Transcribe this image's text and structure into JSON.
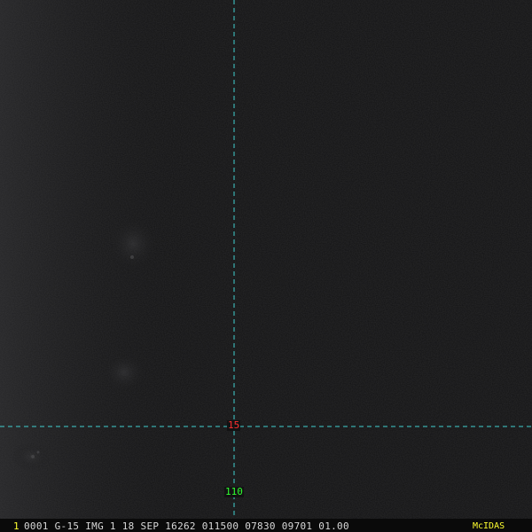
{
  "image_viewer": {
    "colors": {
      "background": "#121213",
      "grid_line": "#40d0d0",
      "latitude_label": "#ff3030",
      "longitude_label": "#30ff30",
      "status_text": "#d8d8d8",
      "highlight": "#ffff30"
    },
    "grid": {
      "latitude_label": "15",
      "longitude_label": "110"
    },
    "status_bar": {
      "frame_number": "1",
      "text": "0001 G-15 IMG     1 18 SEP 16262 011500 07830 09701 01.00",
      "brand": "McIDAS"
    }
  }
}
